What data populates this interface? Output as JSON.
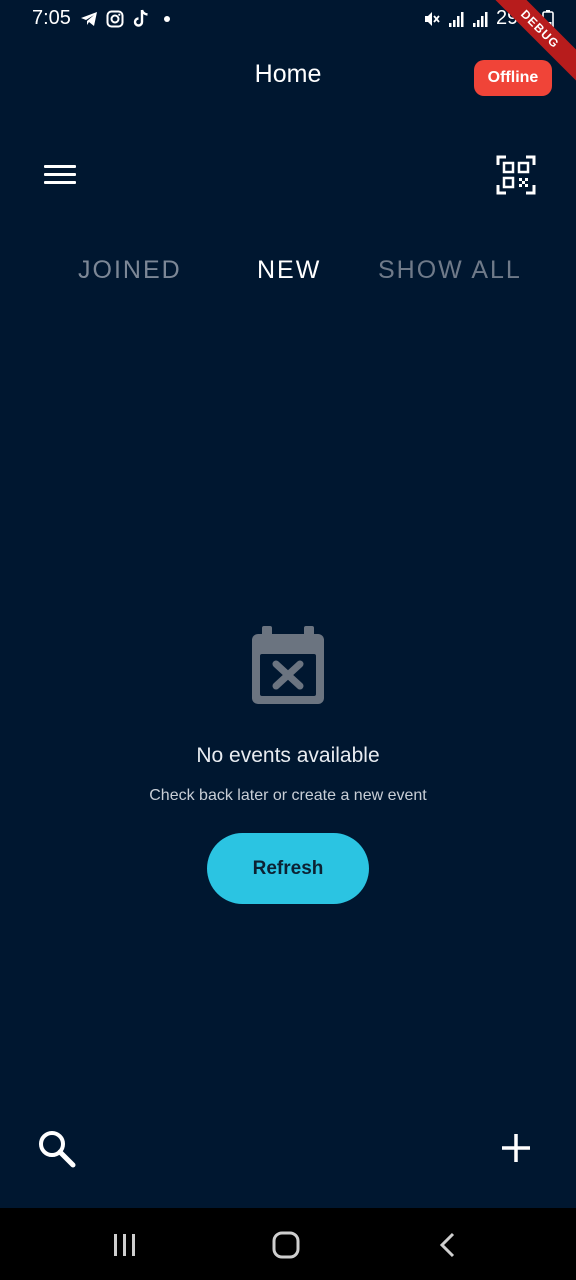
{
  "status_bar": {
    "time": "7:05",
    "battery": "29%",
    "icons": [
      "telegram-icon",
      "instagram-icon",
      "tiktok-icon",
      "notification-dot-icon",
      "mute-icon",
      "signal-icon",
      "signal-icon",
      "battery-icon"
    ]
  },
  "debug_banner": "DEBUG",
  "app_bar": {
    "title": "Home",
    "status_badge": "Offline",
    "status_badge_color": "#f04438"
  },
  "toolbar": {
    "menu_icon": "hamburger-menu-icon",
    "qr_icon": "qr-code-scan-icon"
  },
  "tabs": [
    {
      "label": "JOINED",
      "selected": false
    },
    {
      "label": "NEW",
      "selected": true
    },
    {
      "label": "SHOW ALL",
      "selected": false
    }
  ],
  "empty_state": {
    "icon": "calendar-cancel-icon",
    "title": "No events available",
    "subtitle": "Check back later or create a new event",
    "button_label": "Refresh",
    "button_color": "#2bc4e2"
  },
  "bottom_actions": {
    "search_icon": "search-icon",
    "add_icon": "add-icon"
  },
  "navigation_bar": {
    "icons": [
      "recent-apps-icon",
      "home-icon",
      "back-icon"
    ]
  },
  "colors": {
    "background": "#001730",
    "nav_bar": "#000000"
  }
}
